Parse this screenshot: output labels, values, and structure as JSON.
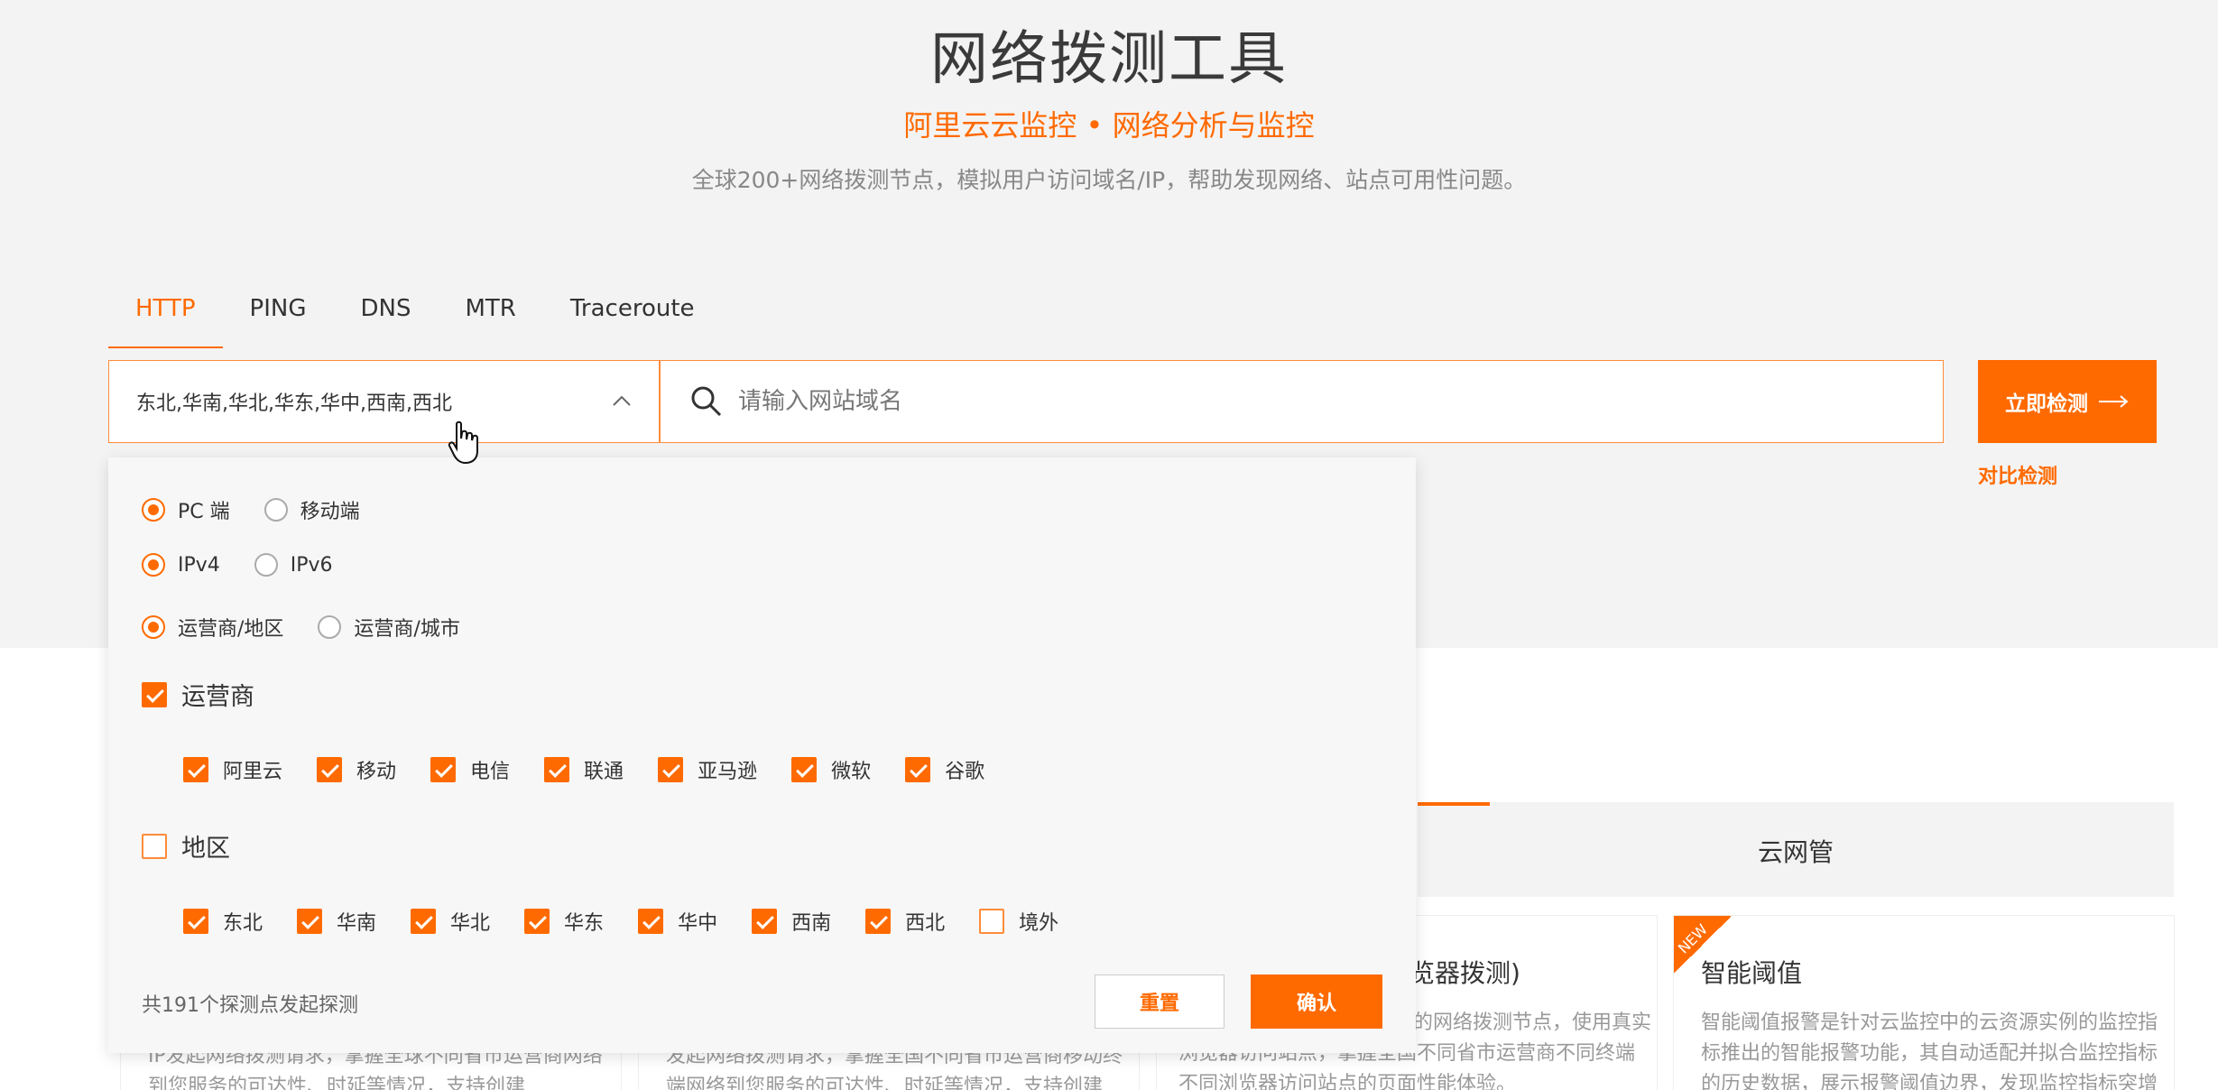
{
  "header": {
    "title": "网络拨测工具",
    "subtitle": "阿里云云监控 • 网络分析与监控",
    "description": "全球200+网络拨测节点，模拟用户访问域名/IP，帮助发现网络、站点可用性问题。"
  },
  "tabs": [
    "HTTP",
    "PING",
    "DNS",
    "MTR",
    "Traceroute"
  ],
  "active_tab": "HTTP",
  "region_select": {
    "value": "东北,华南,华北,华东,华中,西南,西北"
  },
  "search": {
    "placeholder": "请输入网站域名",
    "value": ""
  },
  "submit_label": "立即检测",
  "compare_label": "对比检测",
  "panel": {
    "device": {
      "options": [
        "PC 端",
        "移动端"
      ],
      "selected": "PC 端"
    },
    "ip": {
      "options": [
        "IPv4",
        "IPv6"
      ],
      "selected": "IPv4"
    },
    "grouping": {
      "options": [
        "运营商/地区",
        "运营商/城市"
      ],
      "selected": "运营商/地区"
    },
    "isp_group": {
      "label": "运营商",
      "checked": true
    },
    "isps": [
      "阿里云",
      "移动",
      "电信",
      "联通",
      "亚马逊",
      "微软",
      "谷歌"
    ],
    "region_group": {
      "label": "地区",
      "checked": false
    },
    "regions": [
      {
        "label": "东北",
        "checked": true
      },
      {
        "label": "华南",
        "checked": true
      },
      {
        "label": "华北",
        "checked": true
      },
      {
        "label": "华东",
        "checked": true
      },
      {
        "label": "华中",
        "checked": true
      },
      {
        "label": "西南",
        "checked": true
      },
      {
        "label": "西北",
        "checked": true
      },
      {
        "label": "境外",
        "checked": false
      }
    ],
    "footer_text": "共191个探测点发起探测",
    "reset_label": "重置",
    "confirm_label": "确认"
  },
  "background": {
    "section_tab": "云网管",
    "card3_title": "览器拨测)",
    "card3_lines": [
      "的网络拨测节点，使用真实",
      "浏览器访问站点，掌握全国不同省市运营商不同终端",
      "不同浏览器访问站点的页面性能体验。"
    ],
    "card4_badge": "NEW",
    "card4_title": "智能阈值",
    "card4_lines": [
      "智能阈值报警是针对云监控中的云资源实例的监控指",
      "标推出的智能报警功能，其自动适配并拟合监控指标",
      "的历史数据，展示报警阈值边界，发现监控指标突增"
    ],
    "card1_lines": [
      "IP发起网络拨测请求，掌握全球不同省市运营商网络",
      "到您服务的可达性、时延等情况，支持创建"
    ],
    "card2_lines": [
      "发起网络拨测请求，掌握全国不同省市运营商移动终",
      "端网络到您服务的可达性、时延等情况，支持创建"
    ]
  }
}
